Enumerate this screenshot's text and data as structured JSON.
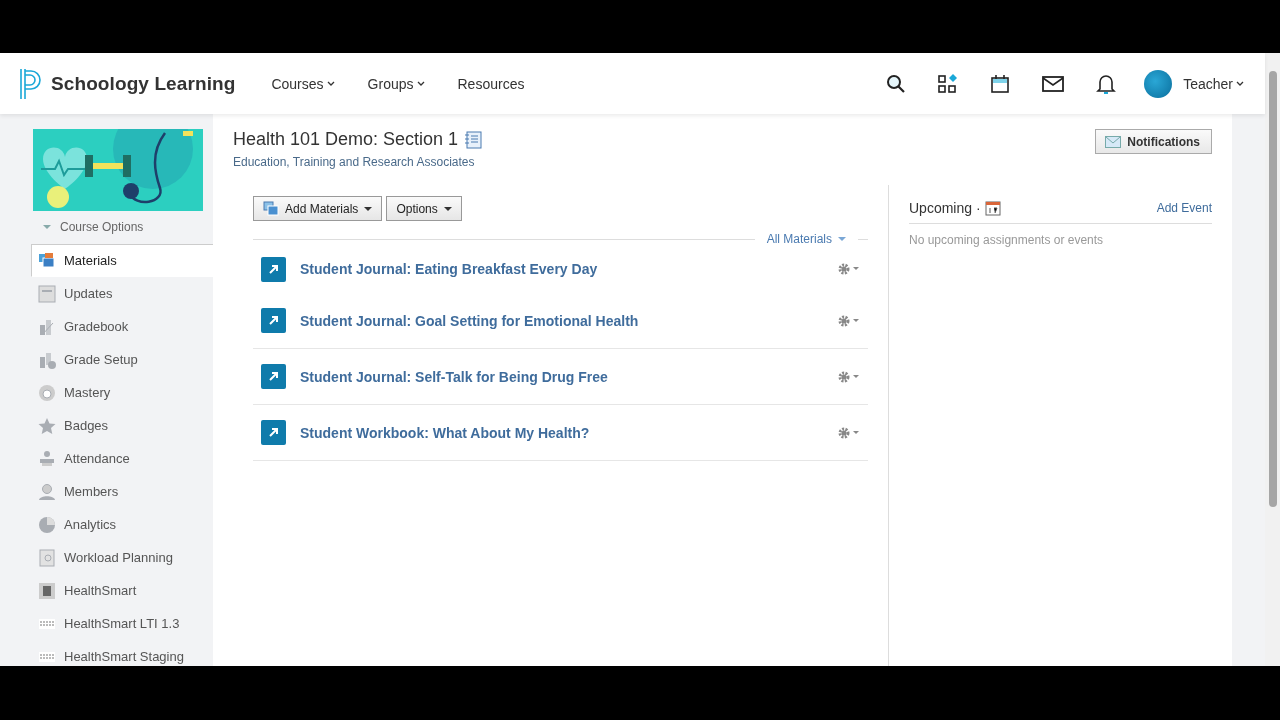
{
  "brand": "Schoology Learning",
  "nav": [
    {
      "label": "Courses",
      "dropdown": true
    },
    {
      "label": "Groups",
      "dropdown": true
    },
    {
      "label": "Resources",
      "dropdown": false
    }
  ],
  "user": {
    "name": "Teacher"
  },
  "sidebar": {
    "course_options": "Course Options",
    "items": [
      {
        "label": "Materials",
        "selected": true
      },
      {
        "label": "Updates",
        "selected": false
      },
      {
        "label": "Gradebook",
        "selected": false
      },
      {
        "label": "Grade Setup",
        "selected": false
      },
      {
        "label": "Mastery",
        "selected": false
      },
      {
        "label": "Badges",
        "selected": false
      },
      {
        "label": "Attendance",
        "selected": false
      },
      {
        "label": "Members",
        "selected": false
      },
      {
        "label": "Analytics",
        "selected": false
      },
      {
        "label": "Workload Planning",
        "selected": false
      },
      {
        "label": "HealthSmart",
        "selected": false
      },
      {
        "label": "HealthSmart LTI 1.3",
        "selected": false
      },
      {
        "label": "HealthSmart Staging",
        "selected": false
      }
    ]
  },
  "course": {
    "title": "Health 101 Demo: Section 1",
    "subtitle": "Education, Training and Research Associates"
  },
  "notifications_button": "Notifications",
  "toolbar": [
    "Add Materials",
    "Options"
  ],
  "filter": "All Materials",
  "materials": [
    {
      "title": "Student Journal: Eating Breakfast Every Day"
    },
    {
      "title": "Student Journal: Goal Setting for Emotional Health"
    },
    {
      "title": "Student Journal: Self-Talk for Being Drug Free"
    },
    {
      "title": "Student Workbook: What About My Health?"
    }
  ],
  "upcoming": {
    "title": "Upcoming ·",
    "add_event": "Add Event",
    "empty": "No upcoming assignments or events"
  }
}
